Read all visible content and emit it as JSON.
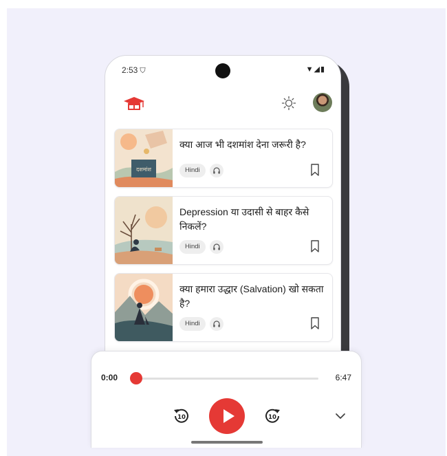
{
  "status": {
    "time": "2:53",
    "vpn_icon": "vpn-key-icon",
    "icons": "▼◢▮"
  },
  "appbar": {
    "logo_icon": "graduation-cap-icon",
    "theme_icon": "sun-icon",
    "avatar_icon": "user-avatar"
  },
  "cards": [
    {
      "title": "क्या आज भी दशमांश देना जरूरी है?",
      "thumb_text": "दशमांश",
      "language": "Hindi",
      "audio_icon": "headphones-icon",
      "bookmark_icon": "bookmark-icon"
    },
    {
      "title": "Depression या उदासी से बाहर कैसे निकलें?",
      "language": "Hindi",
      "audio_icon": "headphones-icon",
      "bookmark_icon": "bookmark-icon"
    },
    {
      "title": "क्या हमारा उद्धार (Salvation) खो सकता है?",
      "language": "Hindi",
      "audio_icon": "headphones-icon",
      "bookmark_icon": "bookmark-icon"
    }
  ],
  "player": {
    "current_time": "0:00",
    "total_time": "6:47",
    "progress": 0.0,
    "rewind_seconds": "10",
    "forward_seconds": "10",
    "play_icon": "play-icon",
    "collapse_icon": "chevron-down-icon"
  },
  "colors": {
    "accent": "#e53935",
    "background": "#f1f0fb"
  }
}
